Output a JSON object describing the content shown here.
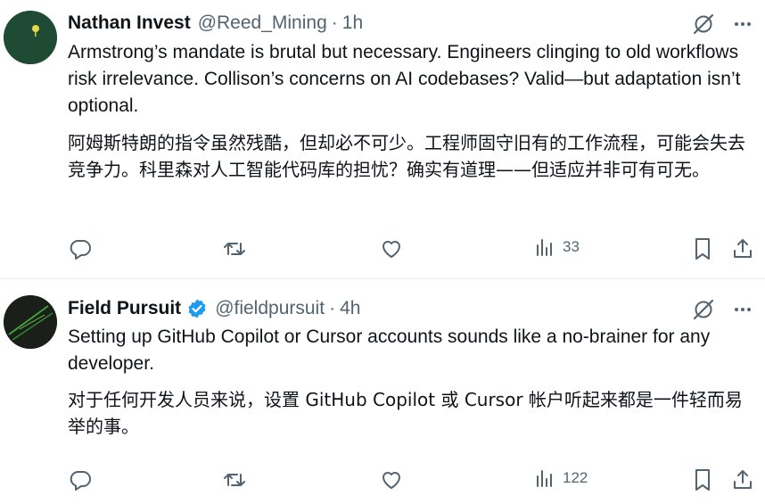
{
  "tweets": [
    {
      "display_name": "Nathan Invest",
      "handle": "@Reed_Mining",
      "separator": "·",
      "time": "1h",
      "verified": false,
      "text_en": "Armstrong’s mandate is brutal but necessary. Engineers clinging to old workflows risk irrelevance. Collison’s concerns on AI codebases? Valid—but adaptation isn’t optional.",
      "text_cn": "阿姆斯特朗的指令虽然残酷，但却必不可少。工程师固守旧有的工作流程，可能会失去竞争力。科里森对人工智能代码库的担忧？确实有道理——但适应并非可有可无。",
      "views": "33"
    },
    {
      "display_name": "Field Pursuit",
      "handle": "@fieldpursuit",
      "separator": "·",
      "time": "4h",
      "verified": true,
      "text_en": "Setting up GitHub Copilot or Cursor accounts sounds like a no-brainer for any developer.",
      "text_cn": "对于任何开发人员来说，设置 GitHub Copilot 或 Cursor 帐户听起来都是一件轻而易举的事。",
      "views": "122"
    }
  ],
  "colors": {
    "text_primary": "#0f1419",
    "text_secondary": "#536471",
    "verified_blue": "#1d9bf0",
    "divider": "#e6ebef"
  },
  "icons": [
    "grok-icon",
    "more-icon",
    "reply-icon",
    "retweet-icon",
    "like-icon",
    "views-icon",
    "bookmark-icon",
    "share-icon",
    "verified-badge-icon"
  ]
}
